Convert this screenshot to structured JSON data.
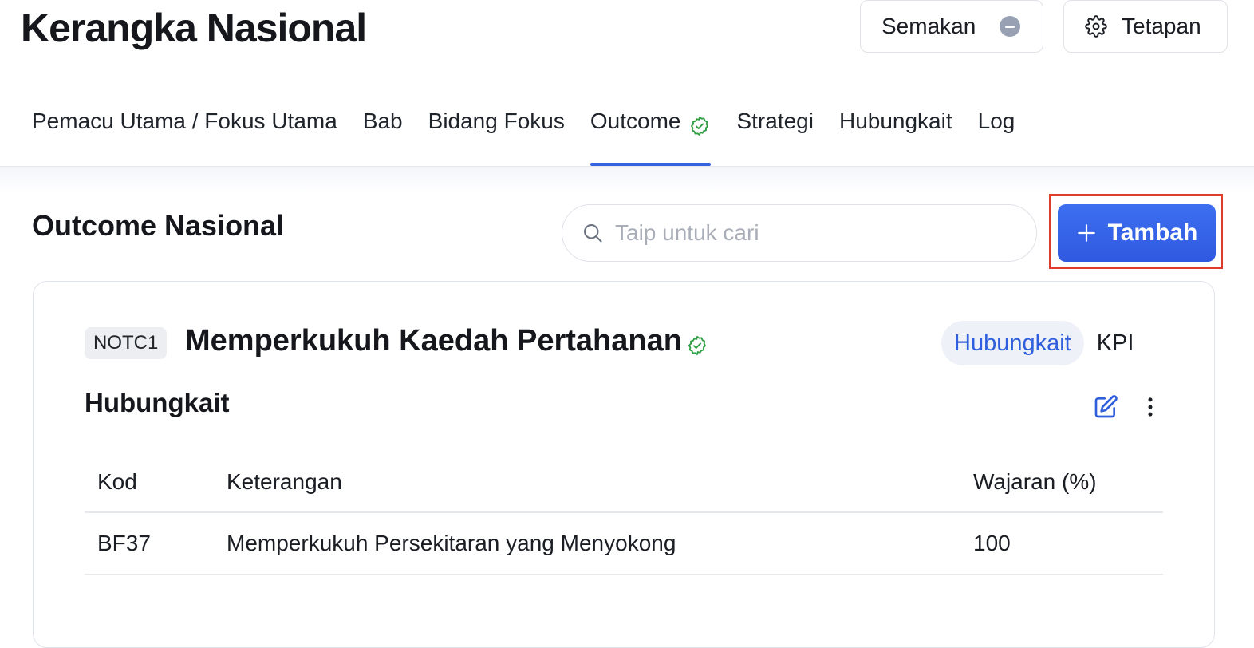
{
  "header": {
    "title": "Kerangka Nasional",
    "semakan_label": "Semakan",
    "tetapan_label": "Tetapan"
  },
  "tabs": [
    {
      "label": "Pemacu Utama / Fokus Utama"
    },
    {
      "label": "Bab"
    },
    {
      "label": "Bidang Fokus"
    },
    {
      "label": "Outcome",
      "active": true,
      "verified": true
    },
    {
      "label": "Strategi"
    },
    {
      "label": "Hubungkait"
    },
    {
      "label": "Log"
    }
  ],
  "section": {
    "title": "Outcome Nasional",
    "search_placeholder": "Taip untuk cari",
    "add_label": "Tambah"
  },
  "card": {
    "code": "NOTC1",
    "title": "Memperkukuh Kaedah Pertahanan",
    "pill_tabs": [
      "Hubungkait",
      "KPI"
    ],
    "active_pill": "Hubungkait",
    "subsection_title": "Hubungkait",
    "table": {
      "headers": [
        "Kod",
        "Keterangan",
        "Wajaran (%)"
      ],
      "rows": [
        [
          "BF37",
          "Memperkukuh Persekitaran yang Menyokong",
          "100"
        ]
      ]
    }
  },
  "icons": {
    "semakan": "minus-circle-icon",
    "tetapan": "gear-icon",
    "verified": "check-badge-icon",
    "search": "search-icon",
    "add": "plus-icon",
    "edit": "edit-icon",
    "more": "kebab-menu-icon"
  },
  "colors": {
    "accent": "#3461e0",
    "verified": "#2f9e44",
    "highlight_border": "#e03b2b"
  }
}
